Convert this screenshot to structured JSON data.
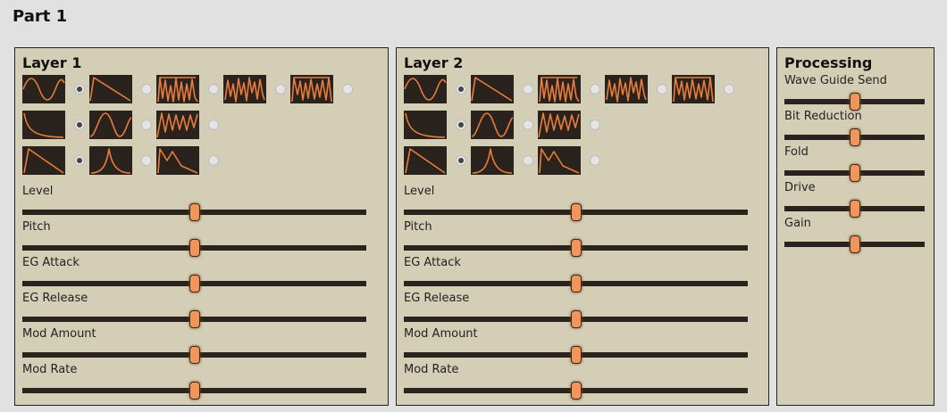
{
  "title": "Part 1",
  "layers": [
    {
      "title": "Layer 1",
      "wave_rows": [
        {
          "waves": [
            "sine",
            "saw-down",
            "noise-a",
            "noise-b",
            "noise-c"
          ],
          "selected": 0
        },
        {
          "waves": [
            "decay",
            "sine-shifted",
            "zigzag"
          ],
          "selected": 0
        },
        {
          "waves": [
            "ramp-decay",
            "pulse-decay",
            "steps"
          ],
          "selected": 0
        }
      ],
      "sliders": [
        {
          "label": "Level",
          "value": 0.5
        },
        {
          "label": "Pitch",
          "value": 0.5
        },
        {
          "label": "EG Attack",
          "value": 0.5
        },
        {
          "label": "EG Release",
          "value": 0.5
        },
        {
          "label": "Mod Amount",
          "value": 0.5
        },
        {
          "label": "Mod Rate",
          "value": 0.5
        }
      ]
    },
    {
      "title": "Layer 2",
      "wave_rows": [
        {
          "waves": [
            "sine",
            "saw-down",
            "noise-a",
            "noise-b",
            "noise-c"
          ],
          "selected": 0
        },
        {
          "waves": [
            "decay",
            "sine-shifted",
            "zigzag"
          ],
          "selected": 0
        },
        {
          "waves": [
            "ramp-decay",
            "pulse-decay",
            "steps"
          ],
          "selected": 0
        }
      ],
      "sliders": [
        {
          "label": "Level",
          "value": 0.5
        },
        {
          "label": "Pitch",
          "value": 0.5
        },
        {
          "label": "EG Attack",
          "value": 0.5
        },
        {
          "label": "EG Release",
          "value": 0.5
        },
        {
          "label": "Mod Amount",
          "value": 0.5
        },
        {
          "label": "Mod Rate",
          "value": 0.5
        }
      ]
    }
  ],
  "processing": {
    "title": "Processing",
    "sliders": [
      {
        "label": "Wave Guide Send",
        "value": 0.5
      },
      {
        "label": "Bit Reduction",
        "value": 0.5
      },
      {
        "label": "Fold",
        "value": 0.5
      },
      {
        "label": "Drive",
        "value": 0.5
      },
      {
        "label": "Gain",
        "value": 0.5
      }
    ]
  },
  "colors": {
    "panel": "#d5ceb6",
    "wave_bg": "#2a221c",
    "wave_line": "#e87d3e",
    "thumb": "#f0955c",
    "track": "#2a221c"
  }
}
